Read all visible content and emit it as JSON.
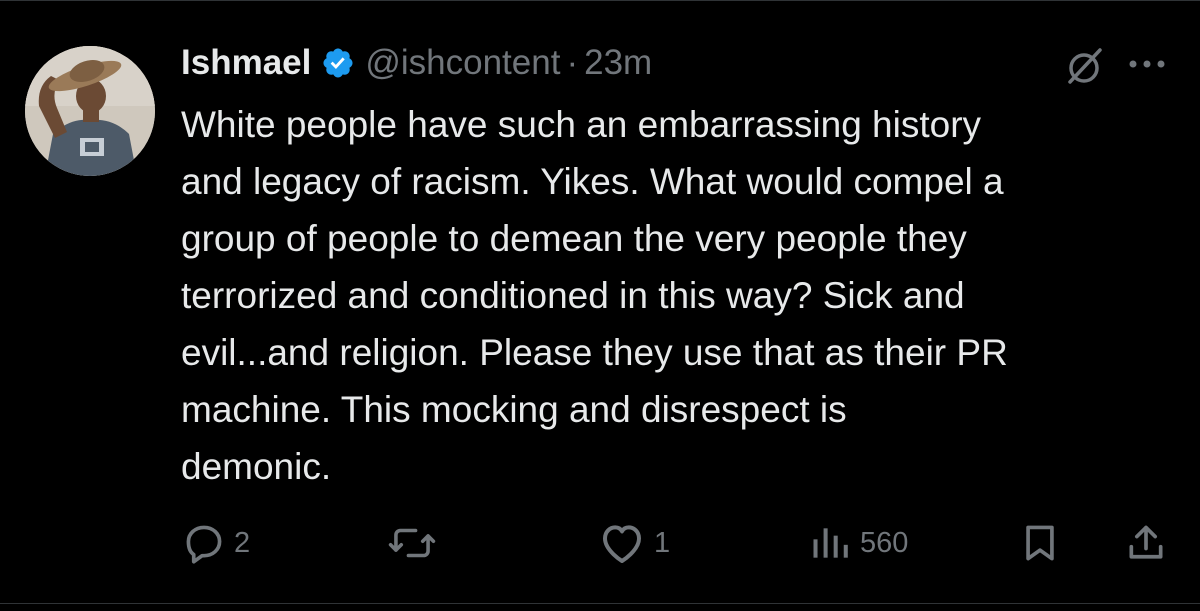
{
  "tweet": {
    "display_name": "Ishmael",
    "handle": "@ishcontent",
    "separator": "·",
    "time": "23m",
    "text": "White people have such an embarrassing history\nand legacy of racism. Yikes. What would compel a\ngroup of people to demean the very people they\nterrorized and conditioned in this way? Sick and\nevil...and religion. Please they use that as their PR\nmachine. This mocking and disrespect is\ndemonic."
  },
  "actions": {
    "reply_count": "2",
    "repost_count": "",
    "like_count": "1",
    "views_count": "560"
  },
  "icons": {
    "verified": "verified-badge-icon",
    "grok": "grok-icon",
    "more": "more-icon",
    "reply": "reply-icon",
    "repost": "repost-icon",
    "like": "heart-icon",
    "views": "views-icon",
    "bookmark": "bookmark-icon",
    "share": "share-icon"
  },
  "colors": {
    "background": "#000000",
    "primary_text": "#e7e9ea",
    "secondary_text": "#71767b",
    "verified_blue": "#1d9bf0",
    "divider": "#2f3336"
  }
}
